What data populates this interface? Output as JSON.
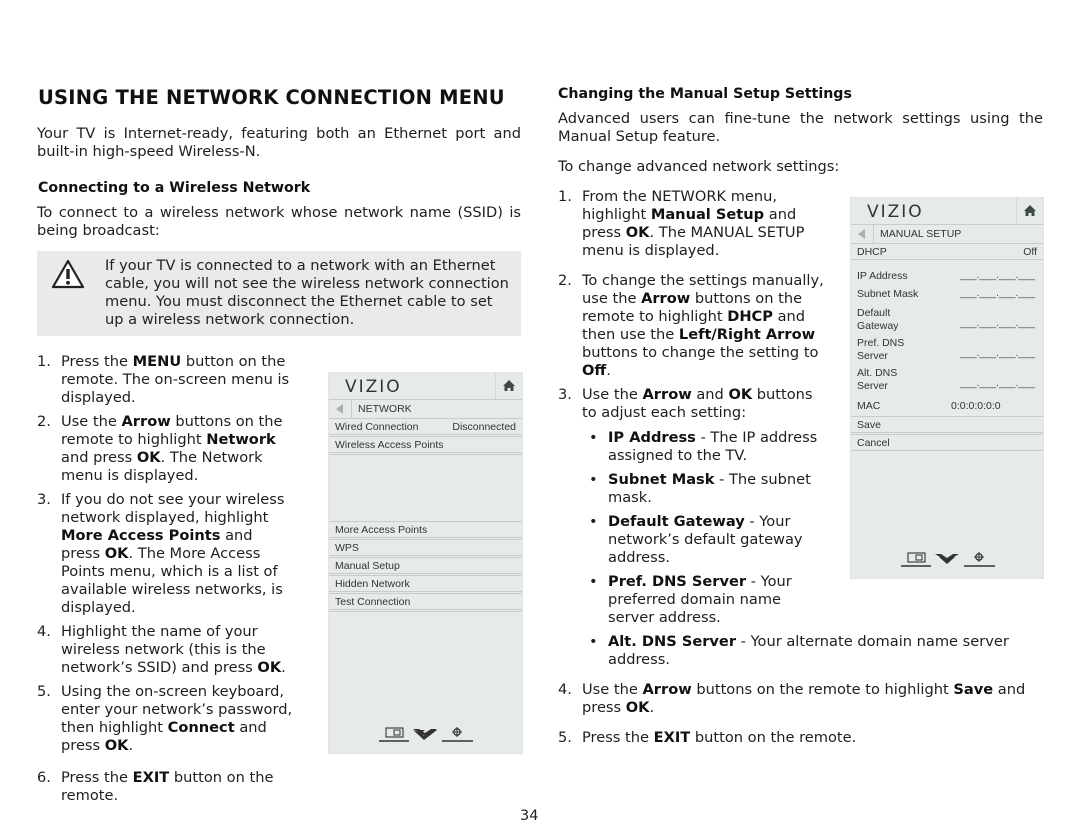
{
  "page": {
    "title": "USING THE NETWORK CONNECTION MENU",
    "intro": "Your TV is Internet-ready, featuring both an Ethernet port and built-in high-speed Wireless-N.",
    "page_number": "34"
  },
  "wireless": {
    "heading": "Connecting to a Wireless Network",
    "lead": "To connect to a wireless network whose network name (SSID) is being broadcast:",
    "note": {
      "icon": "warning-icon",
      "text": "If your TV is connected to a network with an Ethernet cable, you will not see the wireless network connection menu. You must disconnect the Ethernet cable to set up a wireless network connection."
    },
    "steps": [
      {
        "num": "1.",
        "parts": [
          {
            "t": "Press the "
          },
          {
            "b": "MENU"
          },
          {
            "t": " button on the remote. The on-screen menu is displayed."
          }
        ]
      },
      {
        "num": "2.",
        "parts": [
          {
            "t": "Use the "
          },
          {
            "b": "Arrow"
          },
          {
            "t": " buttons on the remote to highlight "
          },
          {
            "b": "Network"
          },
          {
            "t": " and press "
          },
          {
            "b": "OK"
          },
          {
            "t": ". The Network menu is displayed."
          }
        ]
      },
      {
        "num": "3.",
        "parts": [
          {
            "t": "If you do not see your wireless network displayed, highlight "
          },
          {
            "b": "More Access Points"
          },
          {
            "t": " and press "
          },
          {
            "b": "OK"
          },
          {
            "t": ". The More Access Points menu, which is a list of available wireless networks, is displayed."
          }
        ]
      },
      {
        "num": "4.",
        "parts": [
          {
            "t": "Highlight the name of your wireless network (this is the network’s SSID) and press "
          },
          {
            "b": "OK"
          },
          {
            "t": "."
          }
        ]
      },
      {
        "num": "5.",
        "parts": [
          {
            "t": "Using the on-screen keyboard, enter your network’s password, then highlight "
          },
          {
            "b": "Connect"
          },
          {
            "t": " and press "
          },
          {
            "b": "OK"
          },
          {
            "t": "."
          }
        ]
      },
      {
        "num": "6.",
        "parts": [
          {
            "t": "Press the "
          },
          {
            "b": "EXIT"
          },
          {
            "t": " button on the remote."
          }
        ]
      }
    ]
  },
  "network_menu": {
    "logo": "VIZIO",
    "title": "NETWORK",
    "items": [
      {
        "label": "Wired Connection",
        "value": "Disconnected"
      },
      {
        "label": "Wireless Access Points",
        "value": ""
      },
      {
        "label": "More Access Points",
        "value": ""
      },
      {
        "label": "WPS",
        "value": ""
      },
      {
        "label": "Manual Setup",
        "value": ""
      },
      {
        "label": "Hidden Network",
        "value": ""
      },
      {
        "label": "Test Connection",
        "value": ""
      }
    ],
    "footer_icons": [
      "picture-icon",
      "vizio-v-icon",
      "gear-icon"
    ]
  },
  "manual": {
    "heading": "Changing the Manual Setup Settings",
    "lead": "Advanced users can fine-tune the network settings using the Manual Setup feature.",
    "lead2": "To change advanced network settings:",
    "steps": [
      {
        "num": "1.",
        "parts": [
          {
            "t": "From the NETWORK menu, highlight "
          },
          {
            "b": "Manual Setup"
          },
          {
            "t": " and press "
          },
          {
            "b": "OK"
          },
          {
            "t": ". The MANUAL SETUP menu is displayed."
          }
        ]
      },
      {
        "num": "2.",
        "parts": [
          {
            "t": "To change the settings manually, use the "
          },
          {
            "b": "Arrow"
          },
          {
            "t": " buttons on the remote to highlight "
          },
          {
            "b": "DHCP"
          },
          {
            "t": " and then use the "
          },
          {
            "b": "Left/Right Arrow"
          },
          {
            "t": " buttons to change the setting to "
          },
          {
            "b": "Off"
          },
          {
            "t": "."
          }
        ]
      },
      {
        "num": "3.",
        "parts": [
          {
            "t": "Use the "
          },
          {
            "b": "Arrow"
          },
          {
            "t": " and "
          },
          {
            "b": "OK"
          },
          {
            "t": " buttons to adjust each setting:"
          }
        ]
      }
    ],
    "bullets": [
      {
        "b": "IP Address",
        "t": " - The IP address assigned to the TV."
      },
      {
        "b": "Subnet Mask",
        "t": " - The subnet mask."
      },
      {
        "b": "Default Gateway",
        "t": " - Your network’s default gateway address."
      },
      {
        "b": "Pref. DNS Server",
        "t": " - Your preferred domain name server address."
      },
      {
        "b": "Alt. DNS Server",
        "t": " - Your alternate domain name server address."
      }
    ],
    "steps_after": [
      {
        "num": "4.",
        "parts": [
          {
            "t": "Use the "
          },
          {
            "b": "Arrow"
          },
          {
            "t": " buttons on the remote to highlight "
          },
          {
            "b": "Save"
          },
          {
            "t": " and press "
          },
          {
            "b": "OK"
          },
          {
            "t": "."
          }
        ]
      },
      {
        "num": "5.",
        "parts": [
          {
            "t": "Press the "
          },
          {
            "b": "EXIT"
          },
          {
            "t": " button on the remote."
          }
        ]
      }
    ]
  },
  "manual_menu": {
    "logo": "VIZIO",
    "title": "MANUAL SETUP",
    "dhcp": {
      "label": "DHCP",
      "value": "Off"
    },
    "fields": [
      {
        "label": "IP Address",
        "value": "___.___.___.___"
      },
      {
        "label": "Subnet Mask",
        "value": "___.___.___.___"
      },
      {
        "label": "Default Gateway",
        "value": "___.___.___.___"
      },
      {
        "label": "Pref. DNS Server",
        "value": "___.___.___.___"
      },
      {
        "label": "Alt. DNS Server",
        "value": "___.___.___.___"
      }
    ],
    "mac": {
      "label": "MAC",
      "value": "0:0:0:0:0:0"
    },
    "actions": [
      {
        "label": "Save"
      },
      {
        "label": "Cancel"
      }
    ],
    "footer_icons": [
      "picture-icon",
      "vizio-v-icon",
      "gear-icon"
    ]
  }
}
